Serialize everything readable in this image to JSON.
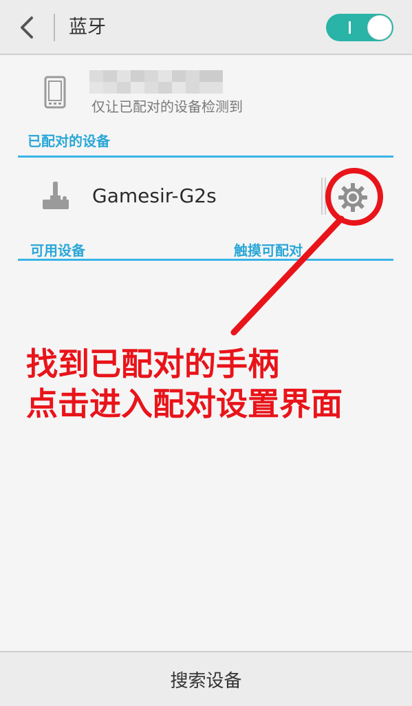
{
  "header": {
    "back_icon": "chevron-left-icon",
    "title": "蓝牙",
    "toggle_on": true,
    "accent_color": "#2ab3a7"
  },
  "local_device": {
    "icon": "phone-icon",
    "visibility_text": "仅让已配对的设备检测到"
  },
  "paired_section": {
    "label": "已配对的设备",
    "devices": [
      {
        "icon": "joystick-icon",
        "name": "Gamesir-G2s",
        "settings_icon": "gear-icon"
      }
    ]
  },
  "available_section": {
    "label": "可用设备",
    "hint": "触摸可配对"
  },
  "annotation": {
    "line1": "找到已配对的手柄",
    "line2": "点击进入配对设置界面",
    "color": "#e8141a"
  },
  "footer": {
    "search_label": "搜索设备"
  },
  "section_color": "#38b4e6"
}
